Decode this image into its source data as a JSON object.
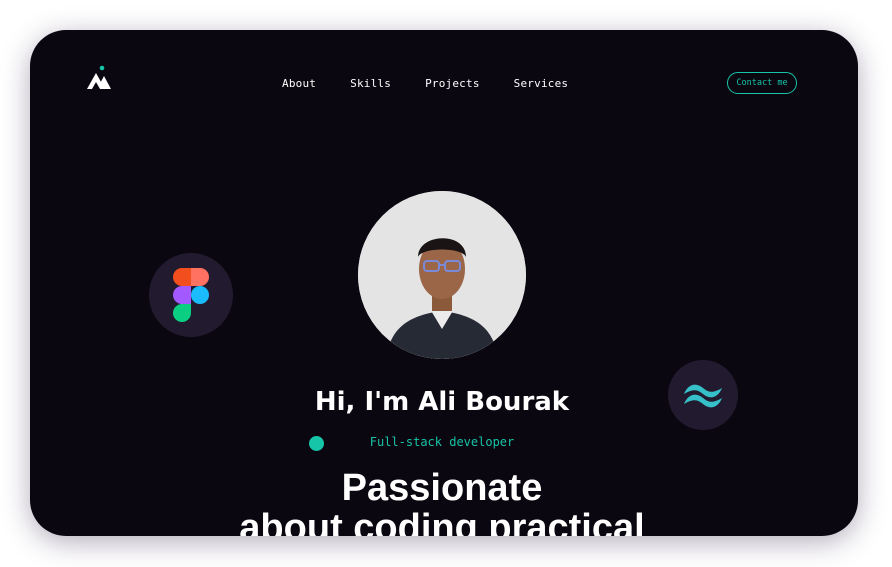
{
  "nav": {
    "items": [
      {
        "label": "About"
      },
      {
        "label": "Skills"
      },
      {
        "label": "Projects"
      },
      {
        "label": "Services"
      }
    ],
    "contact_label": "Contact me"
  },
  "hero": {
    "greeting": "Hi, I'm Ali Bourak",
    "role": "Full-stack developer",
    "headline_line1": "Passionate",
    "headline_line2": "about coding practical"
  },
  "icons": {
    "logo": "ab-logo-icon",
    "bubble_left": "figma-icon",
    "bubble_right": "tailwind-icon"
  },
  "colors": {
    "background": "#0b0710",
    "accent": "#16c4a8",
    "bubble": "#221a2e"
  }
}
